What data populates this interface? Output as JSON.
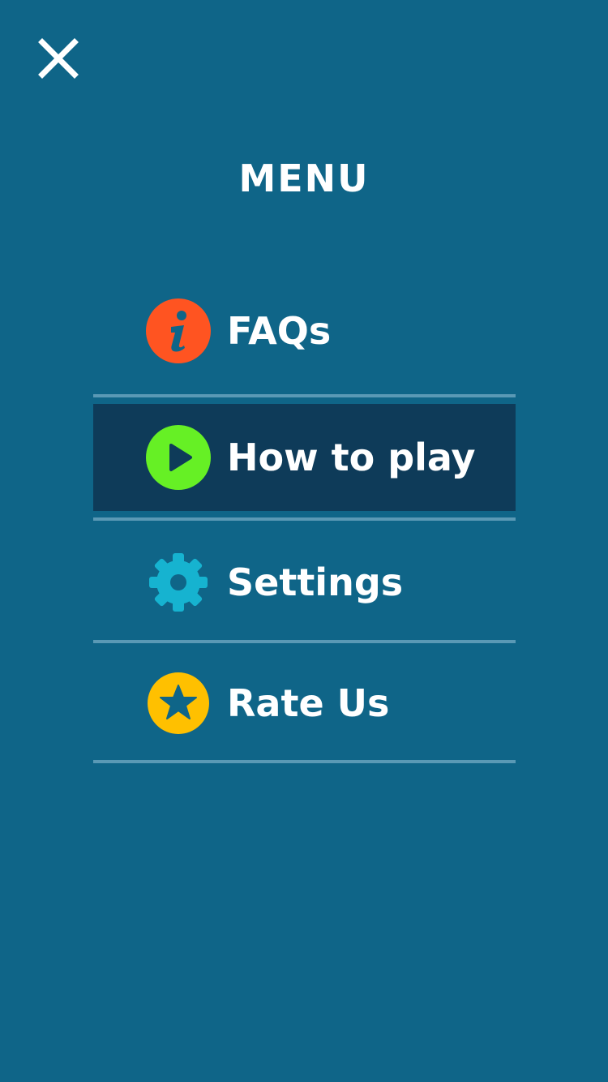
{
  "header": {
    "close_icon": "close-icon",
    "title": "MENU"
  },
  "menu": {
    "items": [
      {
        "label": "FAQs",
        "icon": "info-icon",
        "icon_color": "#ff5421",
        "active": false
      },
      {
        "label": "How to play",
        "icon": "play-icon",
        "icon_color": "#66f025",
        "active": true
      },
      {
        "label": "Settings",
        "icon": "gear-icon",
        "icon_color": "#16b3d0",
        "active": false
      },
      {
        "label": "Rate Us",
        "icon": "star-icon",
        "icon_color": "#ffc000",
        "active": false
      }
    ]
  },
  "colors": {
    "background": "#0f6588",
    "active_row": "#0e3b59",
    "divider": "#5a99b5",
    "text": "#ffffff"
  }
}
